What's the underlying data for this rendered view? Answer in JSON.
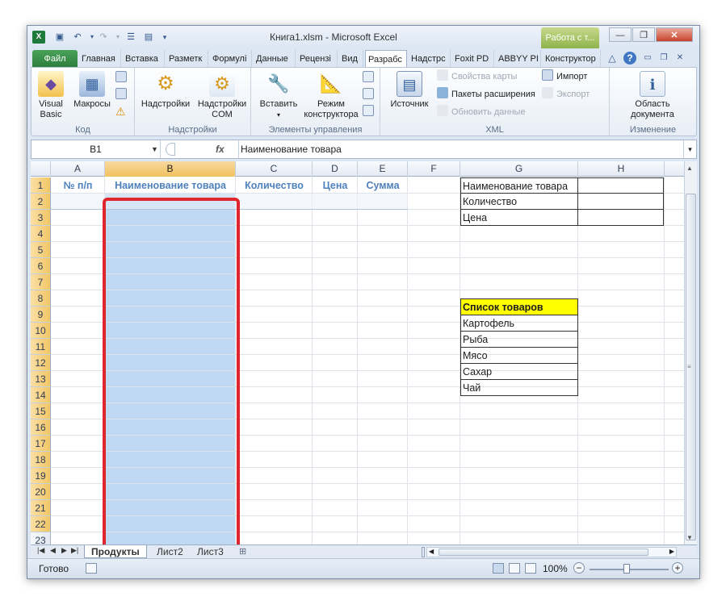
{
  "window": {
    "title": "Книга1.xlsm - Microsoft Excel",
    "context_tab": "Работа с т...",
    "minimize": "—",
    "restore": "❐",
    "close": "✕"
  },
  "quick_access": {
    "excel_icon": "X",
    "save": "💾",
    "undo": "↶",
    "redo": "↷",
    "form": "☰"
  },
  "tabs": [
    {
      "label": "Файл"
    },
    {
      "label": "Главная"
    },
    {
      "label": "Вставка"
    },
    {
      "label": "Разметк"
    },
    {
      "label": "Формулі"
    },
    {
      "label": "Данные"
    },
    {
      "label": "Рецензі"
    },
    {
      "label": "Вид"
    },
    {
      "label": "Разрабс"
    },
    {
      "label": "Надстрс"
    },
    {
      "label": "Foxit PD"
    },
    {
      "label": "ABBYY PI"
    },
    {
      "label": "Конструктор"
    }
  ],
  "ribbon": {
    "groups": {
      "code": "Код",
      "addins": "Надстройки",
      "controls": "Элементы управления",
      "xml": "XML",
      "modify": "Изменение"
    },
    "visual_basic": "Visual Basic",
    "macros": "Макросы",
    "addins_btn": "Надстройки",
    "com_addins": "Надстройки COM",
    "insert": "Вставить",
    "design_mode": "Режим конструктора",
    "source": "Источник",
    "map_props": "Свойства карты",
    "expansion_packs": "Пакеты расширения",
    "refresh_data": "Обновить данные",
    "import": "Импорт",
    "export": "Экспорт",
    "doc_panel": "Область документа"
  },
  "formula_bar": {
    "name_box": "B1",
    "fx": "fx",
    "value": "Наименование товара"
  },
  "columns": [
    "A",
    "B",
    "C",
    "D",
    "E",
    "F",
    "G",
    "H"
  ],
  "rows": [
    "1",
    "2",
    "3",
    "4",
    "5",
    "6",
    "7",
    "8",
    "9",
    "10",
    "11",
    "12",
    "13",
    "14",
    "15",
    "16",
    "17",
    "18",
    "19",
    "20",
    "21",
    "22",
    "23"
  ],
  "table_headers": {
    "A": "№ п/п",
    "B": "Наименование товара",
    "C": "Количество",
    "D": "Цена",
    "E": "Сумма"
  },
  "side_table": {
    "rows": [
      "Наименование товара",
      "Количество",
      "Цена"
    ]
  },
  "product_list": {
    "title": "Список товаров",
    "items": [
      "Картофель",
      "Рыба",
      "Мясо",
      "Сахар",
      "Чай"
    ]
  },
  "sheets": {
    "active": "Продукты",
    "others": [
      "Лист2",
      "Лист3"
    ]
  },
  "status": {
    "ready": "Готово",
    "zoom": "100%"
  },
  "colors": {
    "selection": "#bfd9f5",
    "highlight_border": "#e0262c",
    "list_title_bg": "#ffff00",
    "header_text": "#4f81bd"
  }
}
